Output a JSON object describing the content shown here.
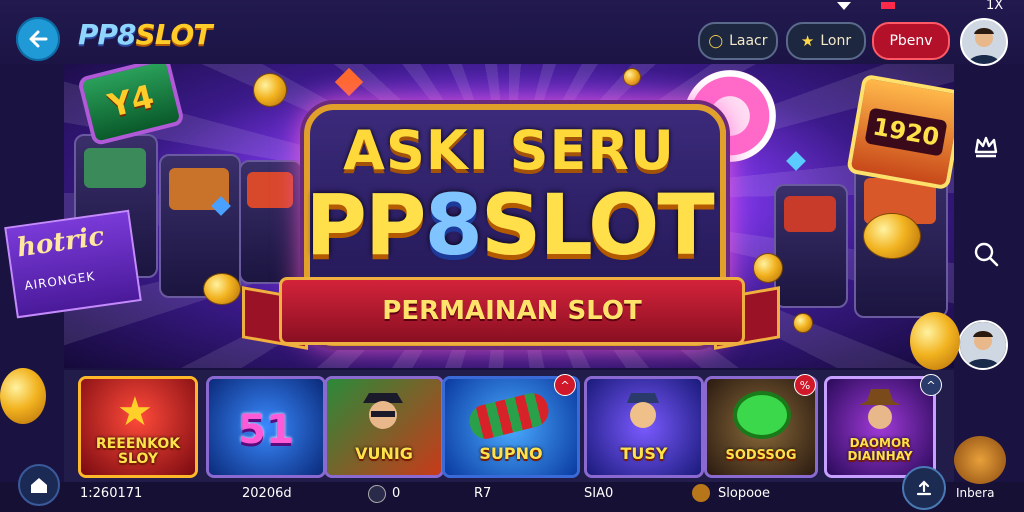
{
  "header": {
    "logo_left": "PP8",
    "logo_right": "SLOT",
    "status_icons": [
      "wifi-icon",
      "signal-icon"
    ],
    "close_label": "1X",
    "pills": [
      {
        "label": "Laacr",
        "icon": "bulb-icon"
      },
      {
        "label": "Lonr",
        "icon": "star-icon"
      },
      {
        "label": "Pbenv"
      }
    ]
  },
  "banner": {
    "headline_1": "ASKI SERU",
    "headline_2_left": "PP",
    "headline_2_mid": "8",
    "headline_2_right": "SLOT",
    "ribbon": "PERMAINAN SLOT",
    "slot_screen_number": "1920",
    "hot_sign_title": "hotric",
    "hot_sign_sub": "AIRONGEK",
    "left_reel_text": "Y4"
  },
  "sidebar": {
    "icons": [
      "crown-icon",
      "search-icon"
    ]
  },
  "games": [
    {
      "label": "REEENKOK\nSLOY",
      "colors": [
        "#e0222a",
        "#7a0a10"
      ],
      "badge": ""
    },
    {
      "label": "51",
      "colors": [
        "#1e5ad8",
        "#0a2a7a"
      ],
      "badge": ""
    },
    {
      "label": "VUNIG",
      "colors": [
        "#c83a1a",
        "#2a7a2a"
      ],
      "badge": ""
    },
    {
      "label": "SUPNO",
      "colors": [
        "#2a8aff",
        "#0a3aa0"
      ],
      "badge": "^"
    },
    {
      "label": "TUSY",
      "colors": [
        "#5a3ae0",
        "#1a1a7a"
      ],
      "badge": ""
    },
    {
      "label": "SODSSOG",
      "colors": [
        "#6a4a2a",
        "#2a1a10"
      ],
      "badge": "%"
    },
    {
      "label": "DAOMOR DIAINHAY",
      "colors": [
        "#8a2ad0",
        "#2a0a5a"
      ],
      "badge": "^"
    }
  ],
  "bottom_bar": {
    "items": [
      "1:260171",
      "20206d",
      "0",
      "R7",
      "SIA0",
      "Slopooe"
    ],
    "right_label": "Inbera"
  },
  "colors": {
    "header_bg": "#221a4f",
    "accent_blue": "#1f9ad6",
    "accent_red": "#b3102a",
    "gold": "#ffcc2a"
  }
}
